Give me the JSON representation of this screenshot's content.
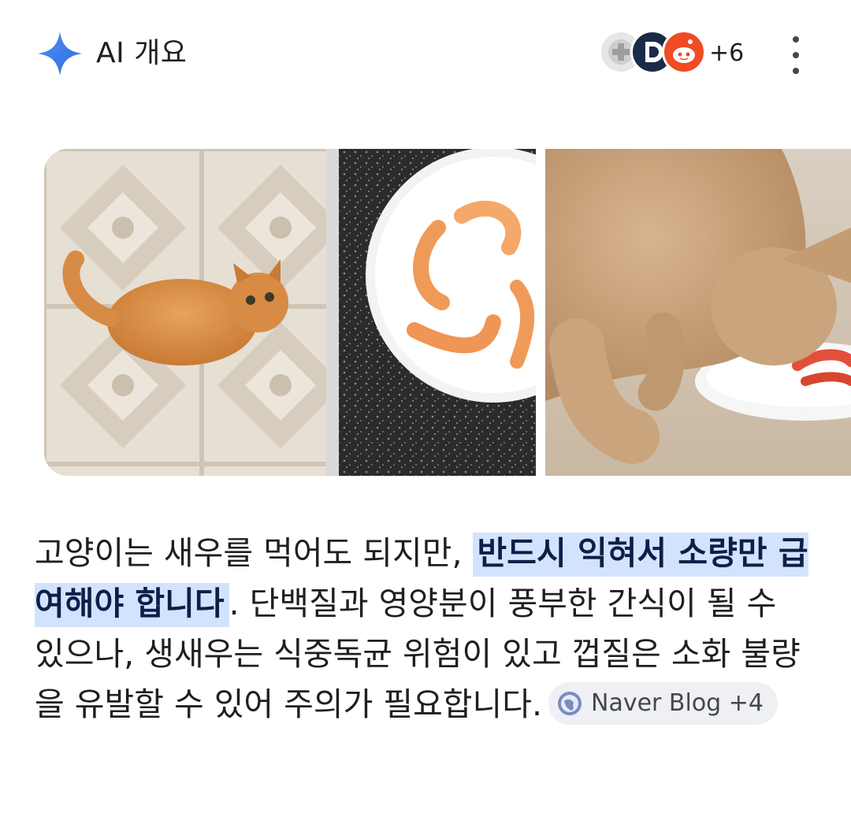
{
  "header": {
    "title": "AI 개요",
    "sources_more": "+6",
    "icons": {
      "sparkle": "sparkle-icon",
      "menu": "more-vert-icon"
    }
  },
  "colors": {
    "sparkle": "#3a7bf2",
    "highlight_bg": "#d3e3fd",
    "chip_bg": "#eef0f4"
  },
  "images": [
    {
      "name": "cat-looking-up-at-shrimp-plate"
    },
    {
      "name": "cat-eating-shrimp"
    }
  ],
  "answer": {
    "part1": "고양이는 새우를 먹어도 되지만, ",
    "highlight": "반드시 익혀서 소량만 급여해야 합니다",
    "part2": ". 단백질과 영양분이 풍부한 간식이 될 수 있으나, 생새우는 식중독균 위험이 있고 껍질은 소화 불량을 유발할 수 있어 주의가 필요합니다.",
    "chip_label": "Naver Blog +4"
  }
}
